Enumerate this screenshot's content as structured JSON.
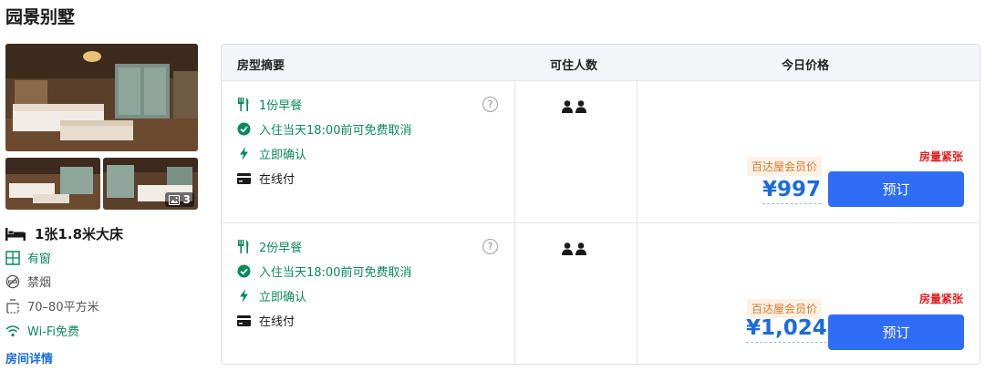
{
  "room": {
    "title": "园景别墅",
    "photo_count": "3",
    "bed": "1张1.8米大床",
    "window": "有窗",
    "smoking": "禁烟",
    "area": "70–80平方米",
    "wifi": "Wi-Fi免费",
    "detail_link": "房间详情"
  },
  "table": {
    "headers": {
      "summary": "房型摘要",
      "guests": "可住人数",
      "price": "今日价格"
    },
    "offers": [
      {
        "breakfast": "1份早餐",
        "cancellation": "入住当天18:00前可免费取消",
        "confirm": "立即确认",
        "payment": "在线付",
        "help": "?",
        "urgency": "房量紧张",
        "member_tag": "百达屋会员价",
        "price": "¥997",
        "book_label": "预订",
        "guest_count": 2
      },
      {
        "breakfast": "2份早餐",
        "cancellation": "入住当天18:00前可免费取消",
        "confirm": "立即确认",
        "payment": "在线付",
        "help": "?",
        "urgency": "房量紧张",
        "member_tag": "百达屋会员价",
        "price": "¥1,024",
        "book_label": "预订",
        "guest_count": 2
      }
    ]
  },
  "icons": {
    "bed": "bed-icon",
    "window": "window-icon",
    "smoking": "no-smoking-icon",
    "area": "area-icon",
    "wifi": "wifi-icon",
    "breakfast": "utensils-icon",
    "cancellation": "check-circle-icon",
    "confirm": "lightning-icon",
    "payment": "card-icon",
    "guest": "person-icon",
    "gallery": "image-icon"
  },
  "colors": {
    "accent": "#2f6df6",
    "price": "#1a6be0",
    "green": "#0a8a5a",
    "urgent": "#e02020",
    "member_tag_bg": "#fdf1e6",
    "member_tag_text": "#d77a2c"
  }
}
